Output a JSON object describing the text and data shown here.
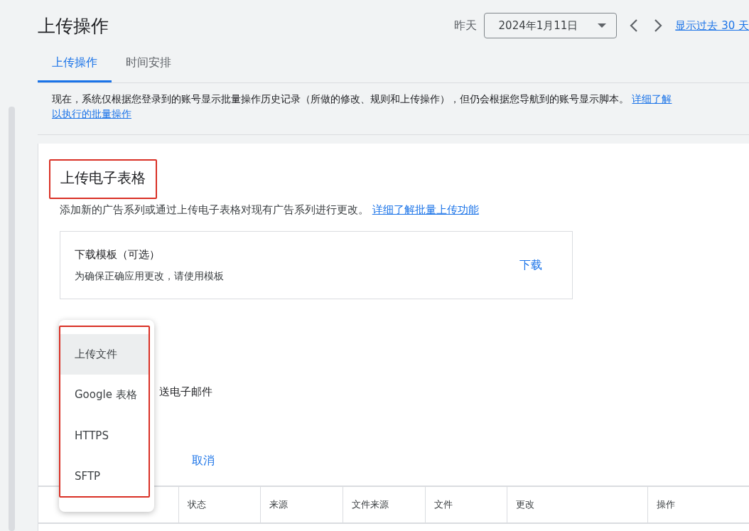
{
  "header": {
    "title": "上传操作",
    "date_label": "昨天",
    "date_value": "2024年1月11日",
    "range_link": "显示过去 30 天"
  },
  "tabs": [
    {
      "label": "上传操作",
      "selected": true
    },
    {
      "label": "时间安排",
      "selected": false
    }
  ],
  "banner": {
    "text": "现在，系统仅根据您登录到的账号显示批量操作历史记录（所做的修改、规则和上传操作），但仍会根据您导航到的账号显示脚本。",
    "link_lines": [
      "详细了解",
      "以执行的批量操作"
    ]
  },
  "card": {
    "title": "上传电子表格",
    "description": "添加新的广告系列或通过上传电子表格对现有广告系列进行更改。",
    "description_link": "详细了解批量上传功能",
    "template": {
      "title": "下载模板（可选）",
      "subtitle": "为确保正确应用更改，请使用模板",
      "action": "下载"
    },
    "email_label": "送电子邮件",
    "cancel": "取消",
    "menu": [
      {
        "label": "上传文件",
        "selected": true
      },
      {
        "label": "Google 表格",
        "selected": false
      },
      {
        "label": "HTTPS",
        "selected": false
      },
      {
        "label": "SFTP",
        "selected": false
      }
    ]
  },
  "table": {
    "columns": [
      "",
      "状态",
      "来源",
      "文件来源",
      "文件",
      "更改",
      "操作"
    ]
  }
}
